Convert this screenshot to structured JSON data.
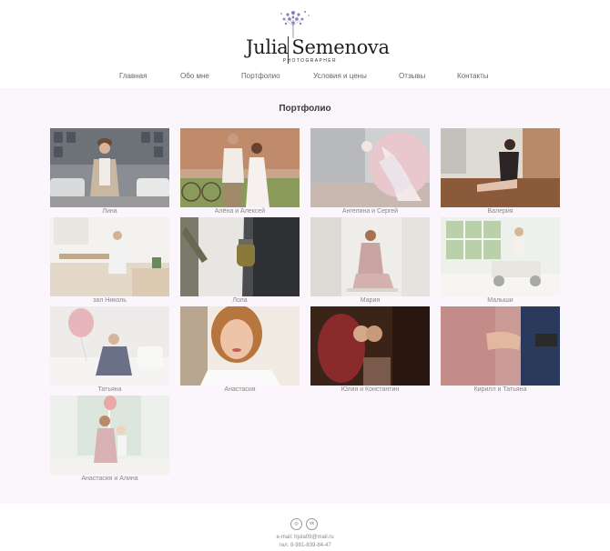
{
  "brand": {
    "name_first": "Julia",
    "name_last": "Semenova",
    "subtitle": "PHOTOGRAPHER"
  },
  "nav": [
    {
      "label": "Главная"
    },
    {
      "label": "Обо мне"
    },
    {
      "label": "Портфолио"
    },
    {
      "label": "Условия и цены"
    },
    {
      "label": "Отзывы"
    },
    {
      "label": "Контакты"
    }
  ],
  "page": {
    "title": "Портфолио"
  },
  "gallery": [
    {
      "caption": "Лина",
      "icon": "photo-street-portrait"
    },
    {
      "caption": "Алёна и Алексей",
      "icon": "photo-couple-outdoor"
    },
    {
      "caption": "Ангелина и Сергей",
      "icon": "photo-pregnancy-hands"
    },
    {
      "caption": "Валерия",
      "icon": "photo-woman-floor"
    },
    {
      "caption": "зал Николь",
      "icon": "photo-studio-kitchen"
    },
    {
      "caption": "Лола",
      "icon": "photo-woman-jar"
    },
    {
      "caption": "Мария",
      "icon": "photo-woman-sitting"
    },
    {
      "caption": "Малыши",
      "icon": "photo-child-toy-car"
    },
    {
      "caption": "Татьяна",
      "icon": "photo-woman-bed-balloons"
    },
    {
      "caption": "Анастасия",
      "icon": "photo-woman-closeup"
    },
    {
      "caption": "Юлия и Константин",
      "icon": "photo-couple-kiss"
    },
    {
      "caption": "Кирилл и Татьяна",
      "icon": "photo-hands-couple"
    },
    {
      "caption": "Анастасия и Алина",
      "icon": "photo-mother-daughter"
    }
  ],
  "footer": {
    "social": [
      {
        "icon": "instagram-icon",
        "glyph": "◎"
      },
      {
        "icon": "vk-icon",
        "glyph": "vk"
      }
    ],
    "email": "e-mail: hjula09@mail.ru",
    "phone": "тел. 8-981-839-84-47"
  }
}
